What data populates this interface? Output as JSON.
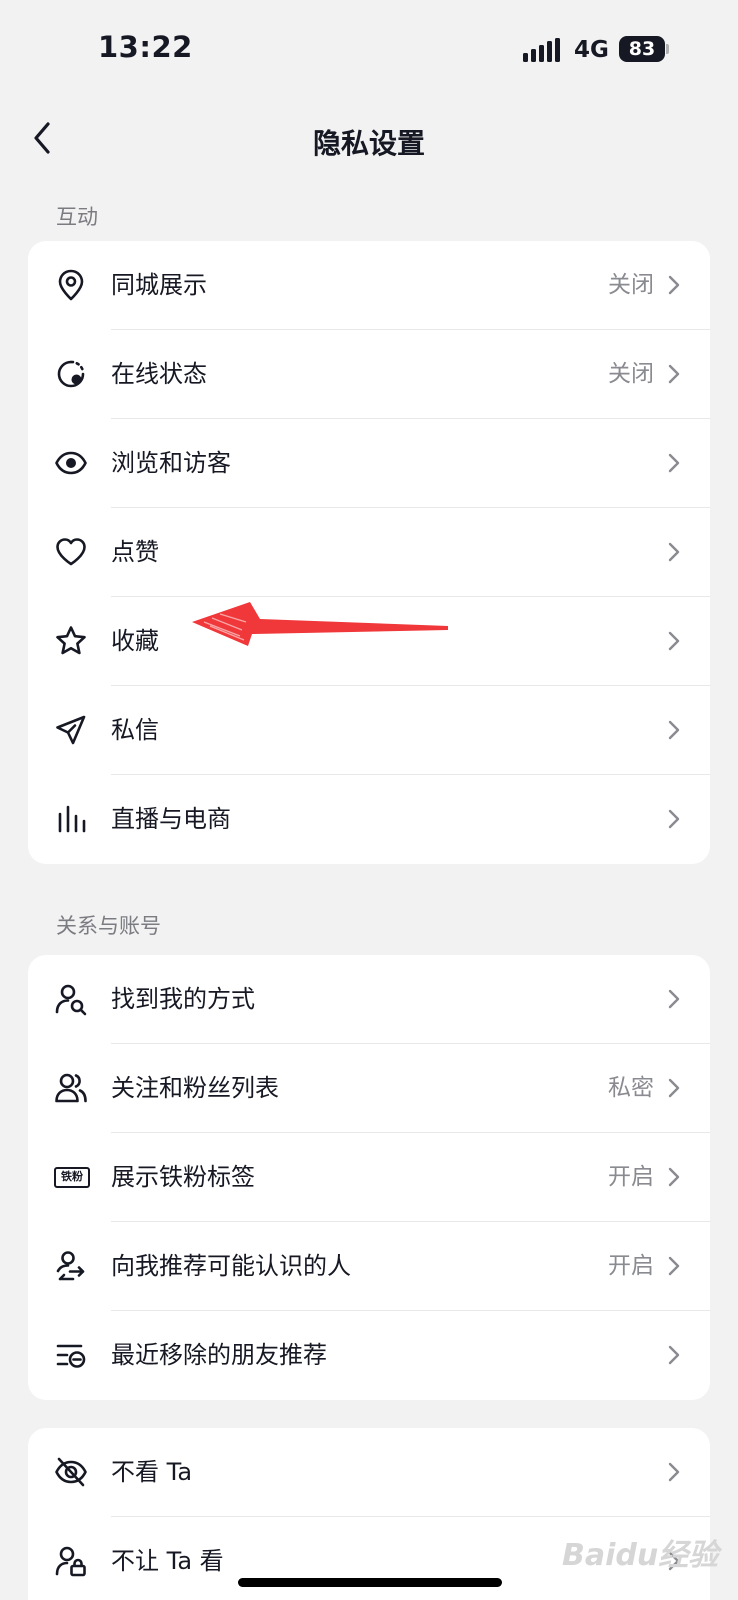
{
  "status_bar": {
    "time": "13:22",
    "network": "4G",
    "battery": "83"
  },
  "nav": {
    "title": "隐私设置"
  },
  "sections": [
    {
      "label": "互动",
      "items": [
        {
          "label": "同城展示",
          "value": "关闭",
          "icon": "location-pin-icon"
        },
        {
          "label": "在线状态",
          "value": "关闭",
          "icon": "online-status-icon"
        },
        {
          "label": "浏览和访客",
          "value": "",
          "icon": "eye-icon"
        },
        {
          "label": "点赞",
          "value": "",
          "icon": "heart-icon"
        },
        {
          "label": "收藏",
          "value": "",
          "icon": "star-icon"
        },
        {
          "label": "私信",
          "value": "",
          "icon": "paper-plane-icon"
        },
        {
          "label": "直播与电商",
          "value": "",
          "icon": "bars-icon"
        }
      ]
    },
    {
      "label": "关系与账号",
      "items": [
        {
          "label": "找到我的方式",
          "value": "",
          "icon": "user-search-icon"
        },
        {
          "label": "关注和粉丝列表",
          "value": "私密",
          "icon": "users-icon"
        },
        {
          "label": "展示铁粉标签",
          "value": "开启",
          "icon": "fan-badge-icon",
          "badge_text": "铁粉"
        },
        {
          "label": "向我推荐可能认识的人",
          "value": "开启",
          "icon": "recommend-icon"
        },
        {
          "label": "最近移除的朋友推荐",
          "value": "",
          "icon": "removed-list-icon"
        }
      ]
    },
    {
      "label": "",
      "items": [
        {
          "label": "不看 Ta",
          "value": "",
          "icon": "eye-off-icon"
        },
        {
          "label": "不让 Ta 看",
          "value": "",
          "icon": "user-lock-icon"
        }
      ]
    }
  ],
  "watermark": "Baidu经验",
  "colors": {
    "background": "#f2f2f2",
    "card": "#ffffff",
    "text": "#161823",
    "secondary": "#8a8b91",
    "annotation": "#f0373a"
  }
}
